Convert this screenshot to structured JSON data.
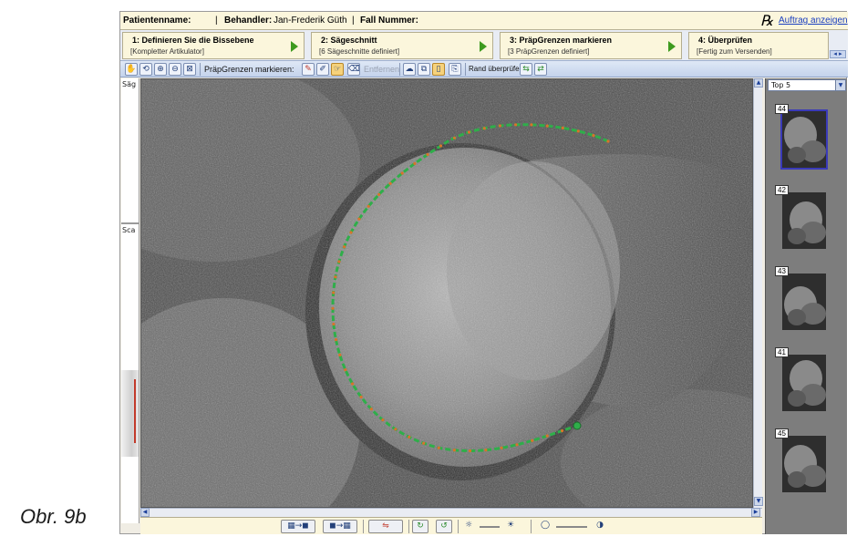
{
  "caption": "Obr. 9b",
  "header": {
    "patient_label": "Patientenname:",
    "patient_value": "",
    "separator": "|",
    "treater_label": "Behandler:",
    "treater_value": "Jan-Frederik Güth",
    "case_label": "Fall Nummer:",
    "case_value": "",
    "rx_icon_glyph": "℞",
    "order_link": "Auftrag anzeigen"
  },
  "steps": [
    {
      "title": "1: Definieren Sie die Bissebene",
      "subtitle": "[Kompletter Artikulator]"
    },
    {
      "title": "2: Sägeschnitt",
      "subtitle": "[6 Sägeschnitte definiert]"
    },
    {
      "title": "3: PräpGrenzen markieren",
      "subtitle": "[3 PräpGrenzen definiert]"
    },
    {
      "title": "4: Überprüfen",
      "subtitle": "[Fertig zum Versenden]"
    }
  ],
  "toolbar": {
    "prep_label": "PräpGrenzen markieren:",
    "remove_label": "Entfernen",
    "check_margin_label": "Rand überprüfen:"
  },
  "left_panel": {
    "label_top": "Säg",
    "label_bottom": "Sca"
  },
  "right_panel": {
    "select_value": "Top 5",
    "thumbnails": [
      {
        "number": "44",
        "selected": true
      },
      {
        "number": "42",
        "selected": false
      },
      {
        "number": "43",
        "selected": false
      },
      {
        "number": "41",
        "selected": false
      },
      {
        "number": "45",
        "selected": false
      }
    ]
  },
  "colors": {
    "margin_line": "#2fae4a",
    "margin_points": "#d8742a",
    "step_arrow": "#3d9a1e",
    "link": "#1b3fbf"
  },
  "icons": {
    "toolbar": [
      "hand-icon",
      "rotate-icon",
      "zoom-in-icon",
      "zoom-out-icon",
      "fit-view-icon",
      "pencil-icon",
      "edit-point-icon",
      "select-point-icon",
      "eraser-icon",
      "cloud-icon",
      "copy-icon",
      "note-icon",
      "paste-icon",
      "margin-check-prev-icon",
      "margin-check-next-icon"
    ],
    "bottom": [
      "model-next-icon",
      "model-prev-icon",
      "toggle-view-icon",
      "rotate-90-icon",
      "rotate-90-back-icon",
      "brightness-low-icon",
      "brightness-high-icon",
      "contrast-low-icon",
      "contrast-high-icon"
    ]
  }
}
